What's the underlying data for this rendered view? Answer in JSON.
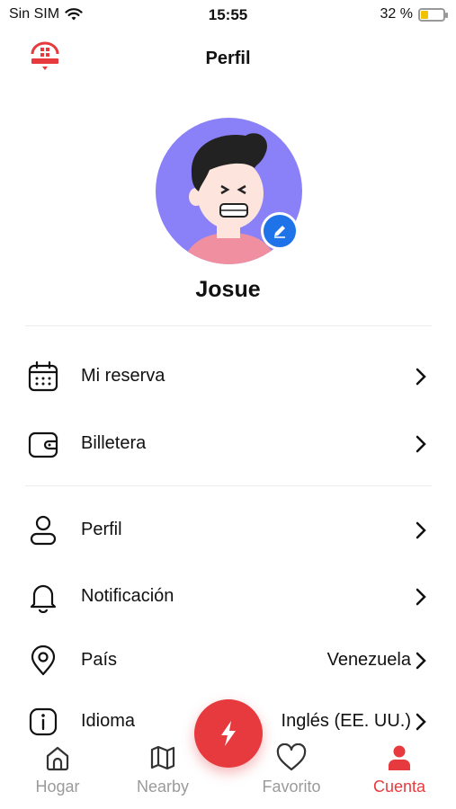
{
  "status_bar": {
    "carrier": "Sin SIM",
    "time": "15:55",
    "battery_text": "32 %",
    "battery_level": 0.32
  },
  "header": {
    "title": "Perfil",
    "logo_icon": "house-logo-icon"
  },
  "profile": {
    "name": "Josue",
    "edit_icon": "pencil-icon"
  },
  "menu": [
    {
      "icon": "calendar-icon",
      "label": "Mi reserva",
      "value": ""
    },
    {
      "icon": "wallet-icon",
      "label": "Billetera",
      "value": ""
    },
    {
      "icon": "user-icon",
      "label": "Perfil",
      "value": ""
    },
    {
      "icon": "bell-icon",
      "label": "Notificación",
      "value": ""
    },
    {
      "icon": "location-pin-icon",
      "label": "País",
      "value": "Venezuela"
    },
    {
      "icon": "info-icon",
      "label": "Idioma",
      "value": "Inglés (EE. UU.)"
    }
  ],
  "bottom_nav": [
    {
      "icon": "home-icon",
      "label": "Hogar",
      "active": false
    },
    {
      "icon": "map-icon",
      "label": "Nearby",
      "active": false
    },
    {
      "icon": "heart-icon",
      "label": "Favorito",
      "active": false
    },
    {
      "icon": "person-icon",
      "label": "Cuenta",
      "active": true
    }
  ],
  "fab": {
    "icon": "lightning-icon"
  },
  "colors": {
    "accent": "#e63a3e",
    "avatar_bg": "#8a80f7",
    "edit_badge": "#1e73e8",
    "inactive": "#9a9a9a"
  }
}
